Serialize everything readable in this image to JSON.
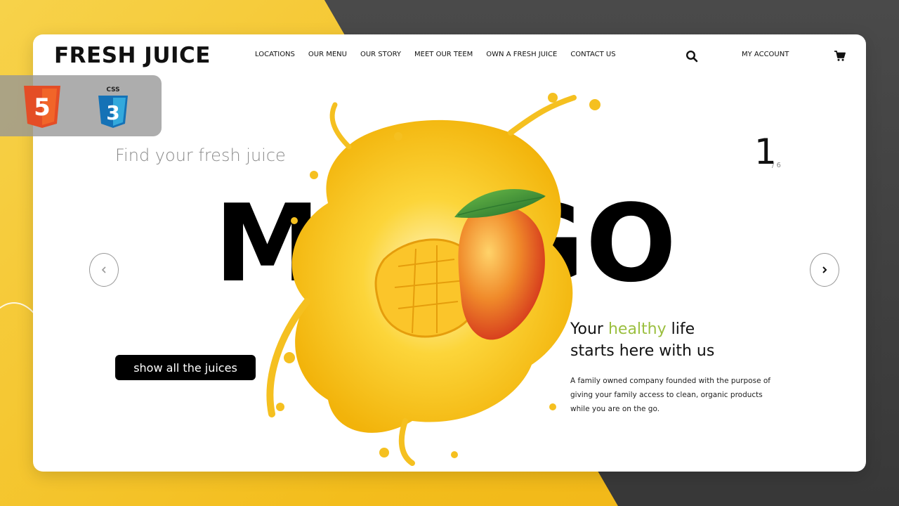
{
  "brand": {
    "logo": "FRESH JUICE"
  },
  "nav": {
    "items": [
      "LOCATIONS",
      "OUR MENU",
      "OUR STORY",
      "MEET OUR TEEM",
      "OWN A FRESH JUICE",
      "CONTACT US"
    ],
    "search_icon": "search-icon",
    "account_label": "MY ACCOUNT",
    "cart_icon": "cart-icon"
  },
  "hero": {
    "tagline": "Find your fresh juice",
    "big_word": "MANGO",
    "slide_current": "1",
    "slide_total": "/ 6",
    "cta_label": "show all the juices",
    "headline_part1": "Your ",
    "headline_accent": "healthy",
    "headline_part2": " life",
    "headline_line2": "starts here with us",
    "description": "A family owned company founded with the purpose of giving your family access to clean, organic products while you are on the go."
  },
  "badge": {
    "html_icon": "html5-icon",
    "css_icon": "css3-icon",
    "css_label": "CSS",
    "html_digit": "5",
    "css_digit": "3"
  },
  "colors": {
    "accent_green": "#9bbf3f",
    "background_yellow": "#f3bd1c",
    "background_dark": "#3f3f3f",
    "juice_yellow": "#f7c21a"
  }
}
